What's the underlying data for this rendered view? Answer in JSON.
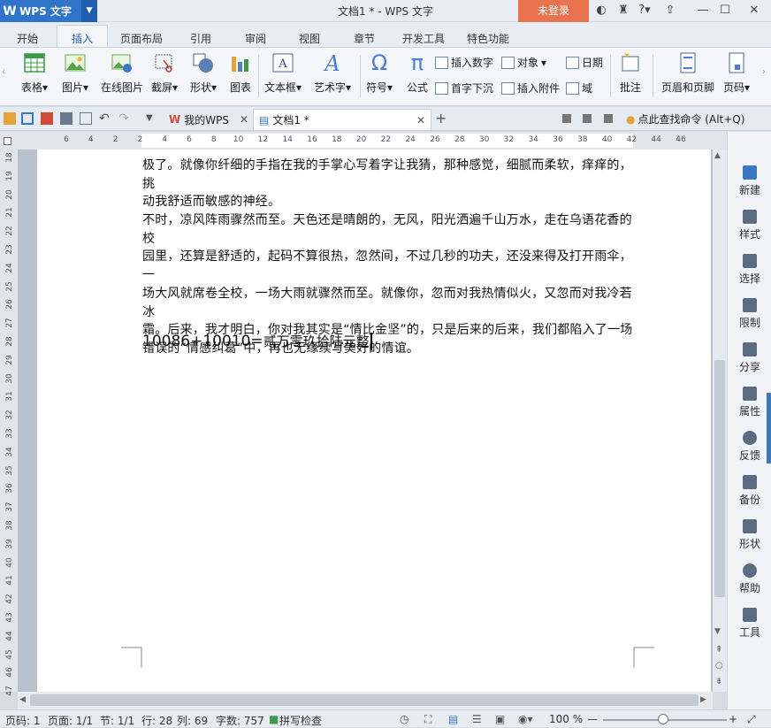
{
  "app": {
    "menu_label": "WPS 文字",
    "window_title": "文档1 * - WPS 文字",
    "login": "未登录"
  },
  "tabs": [
    "开始",
    "插入",
    "页面布局",
    "引用",
    "审阅",
    "视图",
    "章节",
    "开发工具",
    "特色功能"
  ],
  "ribbon": {
    "table": "表格",
    "picture": "图片",
    "online_picture": "在线图片",
    "screenshot": "截屏",
    "shape": "形状",
    "chart": "图表",
    "textbox": "文本框",
    "wordart": "艺术字",
    "symbol": "符号",
    "formula": "公式",
    "insert_number": "插入数字",
    "object": "对象",
    "date": "日期",
    "dropcap": "首字下沉",
    "attachment": "插入附件",
    "field": "域",
    "comment": "批注",
    "header_footer": "页眉和页脚",
    "page_number": "页码"
  },
  "quickbar": {
    "tab1": "我的WPS",
    "tab2": "文档1 *",
    "search": "点此查找命令 (Alt+Q)"
  },
  "ruler": {
    "h": [
      "6",
      "4",
      "2",
      "2",
      "4",
      "6",
      "8",
      "10",
      "12",
      "14",
      "16",
      "18",
      "20",
      "22",
      "24",
      "26",
      "28",
      "30",
      "32",
      "34",
      "36",
      "38",
      "40",
      "42",
      "44",
      "46"
    ],
    "v": [
      "18",
      "19",
      "20",
      "21",
      "22",
      "23",
      "24",
      "25",
      "26",
      "27",
      "28",
      "29",
      "30",
      "31",
      "32",
      "33",
      "34",
      "35",
      "36",
      "37",
      "38",
      "39",
      "40",
      "41",
      "42",
      "43",
      "44",
      "45",
      "46",
      "47"
    ]
  },
  "document": {
    "p1": [
      "极了。就像你纤细的手指在我的手掌心写着字让我猜，那种感觉，细腻而柔软，痒痒的，挑",
      "动我舒适而敏感的神经。"
    ],
    "p2": [
      "不时，凉风阵雨骤然而至。天色还是晴朗的，无风，阳光洒遍千山万水，走在乌语花香的校",
      "园里，还算是舒适的，起码不算很热，忽然间，不过几秒的功夫，还没来得及打开雨伞，一",
      "场大风就席卷全校，一场大雨就骤然而至。就像你，忽而对我热情似火，又忽而对我冷若冰",
      "霜。后来，我才明白，你对我其实是“情比金坚”的，只是后来的后来，我们都陷入了一场",
      "错误的“情感纠葛”中，再也无缘续写美好的情谊。"
    ],
    "formula_left": "10086+10010=",
    "formula_right": "贰万零玖拾陆元整"
  },
  "sidebar": [
    "新建",
    "样式",
    "选择",
    "限制",
    "分享",
    "属性",
    "反馈",
    "备份",
    "形状",
    "帮助",
    "工具"
  ],
  "status": {
    "page": "页码: 1",
    "pages": "页面: 1/1",
    "section": "节: 1/1",
    "row": "行: 28",
    "col": "列: 69",
    "words": "字数: 757",
    "spell": "拼写检查",
    "zoom": "100 %"
  },
  "colors": {
    "accent": "#2f74c9",
    "login": "#e8734e"
  }
}
